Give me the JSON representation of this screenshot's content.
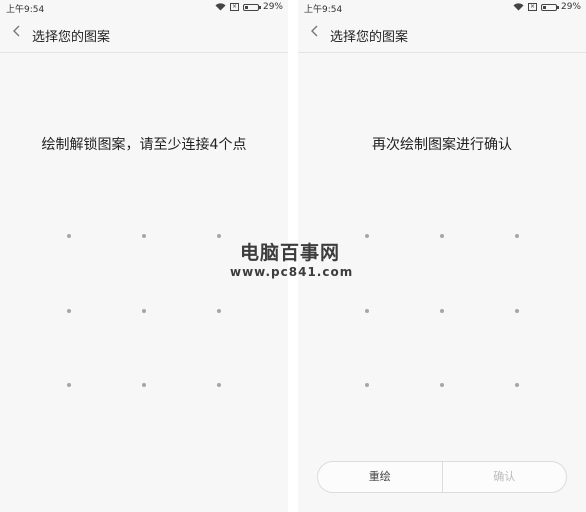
{
  "screens": [
    {
      "status": {
        "time": "上午9:54",
        "battery": "29%",
        "battery_level": 0.29
      },
      "title": "选择您的图案",
      "instruction": "绘制解锁图案，请至少连接4个点"
    },
    {
      "status": {
        "time": "上午9:54",
        "battery": "29%",
        "battery_level": 0.29
      },
      "title": "选择您的图案",
      "instruction": "再次绘制图案进行确认",
      "buttons": {
        "redraw": "重绘",
        "confirm": "确认"
      }
    }
  ],
  "watermark": {
    "main": "电脑百事网",
    "url": "www.pc841.com"
  },
  "colors": {
    "background": "#f7f7f7",
    "dot": "#a6a6a6",
    "confirm_disabled": "#bbbbbb"
  },
  "icons": [
    "back-chevron-icon",
    "wifi-icon",
    "sim-icon",
    "battery-icon"
  ]
}
